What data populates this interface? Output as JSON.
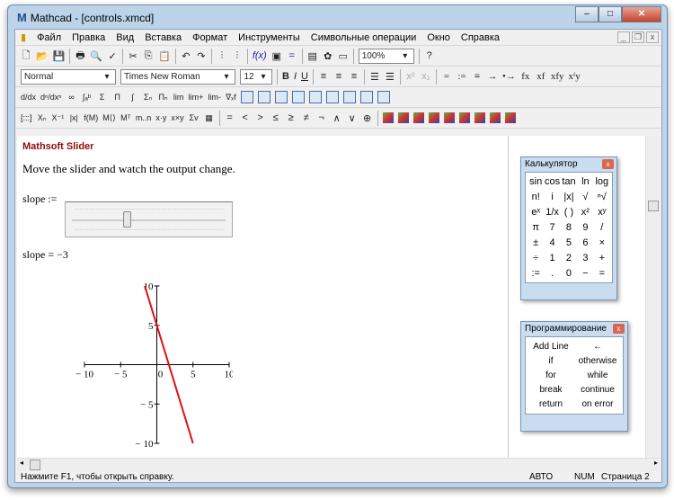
{
  "window": {
    "title": "Mathcad - [controls.xmcd]",
    "logo": "M"
  },
  "menu": [
    "Файл",
    "Правка",
    "Вид",
    "Вставка",
    "Формат",
    "Инструменты",
    "Символьные операции",
    "Окно",
    "Справка"
  ],
  "toolbar1": {
    "zoom": "100%"
  },
  "toolbar2": {
    "style": "Normal",
    "font": "Times New Roman",
    "size": "12",
    "bold": "B",
    "italic": "I",
    "underline": "U",
    "eval": [
      "=",
      ":=",
      "≡",
      "→",
      "•→",
      "fx",
      "xf",
      "xfy",
      "xᶠy"
    ]
  },
  "toolbar3": [
    "d/dx",
    "dⁿ/dxⁿ",
    "∞",
    "∫ₐᵇ",
    "Σ",
    "Π",
    "∫",
    "Σₙ",
    "Πₙ",
    "lim",
    "lim+",
    "lim-",
    "∇ₓf"
  ],
  "toolbar4": [
    "[:::]",
    "Xₙ",
    "X⁻¹",
    "|x|",
    "f(M)",
    "M⟨⟩",
    "Mᵀ",
    "m..n",
    "x·y",
    "x×y",
    "Σv",
    "▦"
  ],
  "toolbar4b": [
    "=",
    "<",
    ">",
    "≤",
    "≥",
    "≠",
    "¬",
    "∧",
    "∨",
    "⊕"
  ],
  "document": {
    "heading": "Mathsoft Slider",
    "text": "Move the slider and watch the output change.",
    "slope_def": "slope :=",
    "slope_result": "slope = −3",
    "slider_value": -3,
    "slider_range": [
      -10,
      10
    ]
  },
  "chart_data": {
    "type": "line",
    "function": "y = slope·x + 5",
    "slope": -3,
    "intercept": 5,
    "xlim": [
      -10,
      10
    ],
    "ylim": [
      -10,
      10
    ],
    "xticks": [
      "− 10",
      "− 5",
      "0",
      "5",
      "10"
    ],
    "yticks": [
      "10",
      "5",
      "− 5",
      "− 10"
    ],
    "series": [
      {
        "name": "y",
        "color": "#dd1111",
        "points": [
          [
            -1.667,
            10
          ],
          [
            5,
            -10
          ]
        ]
      }
    ]
  },
  "calculator": {
    "title": "Калькулятор",
    "keys": [
      "sin",
      "cos",
      "tan",
      "ln",
      "log",
      "n!",
      "i",
      "|x|",
      "√",
      "ⁿ√",
      "eˣ",
      "1/x",
      "( )",
      "x²",
      "xʸ",
      "π",
      "7",
      "8",
      "9",
      "/",
      "±",
      "4",
      "5",
      "6",
      "×",
      "÷",
      "1",
      "2",
      "3",
      "+",
      ":=",
      ".",
      "0",
      "−",
      "="
    ]
  },
  "programming": {
    "title": "Программирование",
    "keys": [
      "Add Line",
      "←",
      "if",
      "otherwise",
      "for",
      "while",
      "break",
      "continue",
      "return",
      "on error"
    ]
  },
  "status": {
    "help": "Нажмите F1, чтобы открыть справку.",
    "auto": "АВТО",
    "num": "NUM",
    "page": "Страница 2"
  }
}
